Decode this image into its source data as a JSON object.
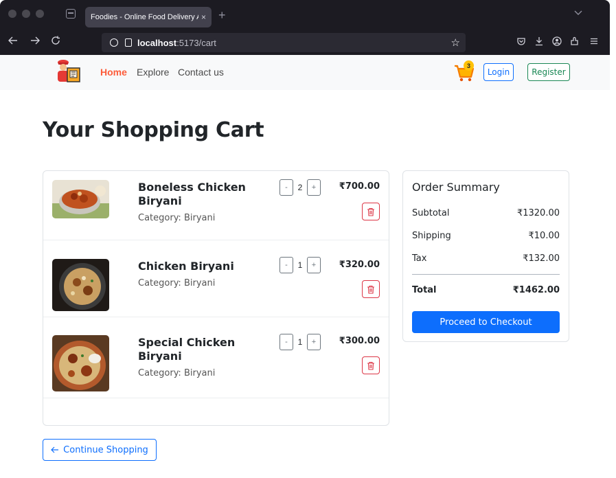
{
  "browser": {
    "tab_title": "Foodies - Online Food Delivery App",
    "tab_close": "×",
    "new_tab": "+",
    "url_host": "localhost",
    "url_path": ":5173/cart"
  },
  "nav": {
    "links": [
      "Home",
      "Explore",
      "Contact us"
    ],
    "cart_count": "3",
    "login_label": "Login",
    "register_label": "Register"
  },
  "page": {
    "title": "Your Shopping Cart"
  },
  "cart": {
    "items": [
      {
        "name": "Boneless Chicken Biryani",
        "category": "Category: Biryani",
        "quantity": "2",
        "price": "₹700.00"
      },
      {
        "name": "Chicken Biryani",
        "category": "Category: Biryani",
        "quantity": "1",
        "price": "₹320.00"
      },
      {
        "name": "Special Chicken Biryani",
        "category": "Category: Biryani",
        "quantity": "1",
        "price": "₹300.00"
      }
    ],
    "minus": "-",
    "plus": "+"
  },
  "summary": {
    "title": "Order Summary",
    "subtotal_label": "Subtotal",
    "subtotal_value": "₹1320.00",
    "shipping_label": "Shipping",
    "shipping_value": "₹10.00",
    "tax_label": "Tax",
    "tax_value": "₹132.00",
    "total_label": "Total",
    "total_value": "₹1462.00",
    "checkout_label": "Proceed to Checkout"
  },
  "continue_label": "Continue Shopping",
  "colors": {
    "brand": "#fd5c3a",
    "primary": "#0d6efd",
    "success": "#198754",
    "danger": "#dc3545",
    "badge": "#ffc107"
  }
}
